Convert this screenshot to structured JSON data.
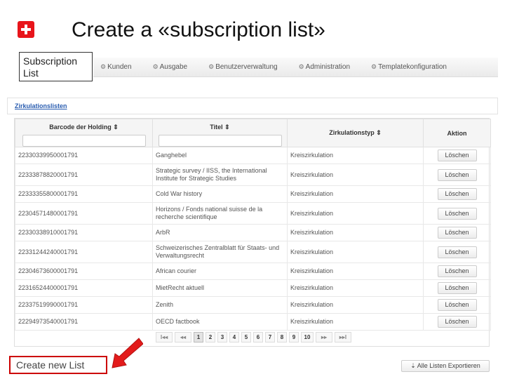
{
  "slide": {
    "title": "Create a «subscription list»"
  },
  "callouts": {
    "top": "Subscription List",
    "bottom": "Create new List"
  },
  "nav": [
    {
      "label": "Kunden",
      "icon": "gear-icon"
    },
    {
      "label": "Ausgabe",
      "icon": "gear-icon"
    },
    {
      "label": "Benutzerverwaltung",
      "icon": "gear-icon"
    },
    {
      "label": "Administration",
      "icon": "gear-icon"
    },
    {
      "label": "Templatekonfiguration",
      "icon": "gear-icon"
    }
  ],
  "breadcrumb": "Zirkulationslisten",
  "table": {
    "headers": {
      "barcode": "Barcode der Holding",
      "titel": "Titel",
      "typ": "Zirkulationstyp",
      "aktion": "Aktion"
    },
    "sort_glyph": "⇕",
    "rows": [
      {
        "barcode": "22330339950001791",
        "titel": "Ganghebel",
        "typ": "Kreiszirkulation",
        "aktion": "Löschen"
      },
      {
        "barcode": "22333878820001791",
        "titel": "Strategic survey / IISS, the International Institute for Strategic Studies",
        "typ": "Kreiszirkulation",
        "aktion": "Löschen"
      },
      {
        "barcode": "22333355800001791",
        "titel": "Cold War history",
        "typ": "Kreiszirkulation",
        "aktion": "Löschen"
      },
      {
        "barcode": "22304571480001791",
        "titel": "Horizons / Fonds national suisse de la recherche scientifique",
        "typ": "Kreiszirkulation",
        "aktion": "Löschen"
      },
      {
        "barcode": "22330338910001791",
        "titel": "ArbR",
        "typ": "Kreiszirkulation",
        "aktion": "Löschen"
      },
      {
        "barcode": "22331244240001791",
        "titel": "Schweizerisches Zentralblatt für Staats- und Verwaltungsrecht",
        "typ": "Kreiszirkulation",
        "aktion": "Löschen"
      },
      {
        "barcode": "22304673600001791",
        "titel": "African courier",
        "typ": "Kreiszirkulation",
        "aktion": "Löschen"
      },
      {
        "barcode": "22316524400001791",
        "titel": "MietRecht aktuell",
        "typ": "Kreiszirkulation",
        "aktion": "Löschen"
      },
      {
        "barcode": "22337519990001791",
        "titel": "Zenith",
        "typ": "Kreiszirkulation",
        "aktion": "Löschen"
      },
      {
        "barcode": "22294973540001791",
        "titel": "OECD factbook",
        "typ": "Kreiszirkulation",
        "aktion": "Löschen"
      }
    ]
  },
  "pagination": {
    "first": "I◂◂",
    "prev": "◂◂",
    "pages": [
      "1",
      "2",
      "3",
      "4",
      "5",
      "6",
      "7",
      "8",
      "9",
      "10"
    ],
    "current": "1",
    "next": "▸▸",
    "last": "▸▸I"
  },
  "export_button": "⇣ Alle Listen Exportieren",
  "colors": {
    "swiss_red": "#e8151b",
    "callout_red": "#cc0000",
    "arrow_red": "#e31b1b",
    "link_blue": "#2a5db0"
  }
}
